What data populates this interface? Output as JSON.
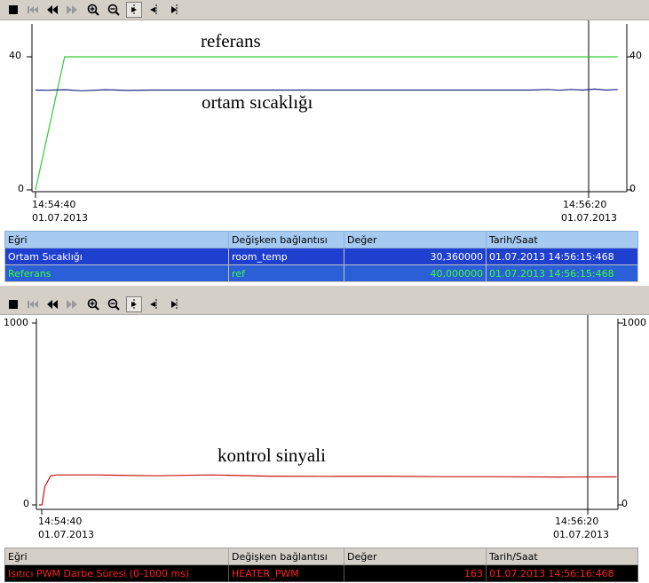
{
  "toolbar": {
    "buttons": [
      "stop-icon",
      "first-icon",
      "rewind-icon",
      "forward-icon",
      "zoom-in-icon",
      "zoom-out-icon",
      "select-icon",
      "pan-icon",
      "cursor-icon"
    ]
  },
  "panel1": {
    "annotations": {
      "referans": "referans",
      "ortam": "ortam sıcaklığı"
    },
    "y_ticks": {
      "top": "40",
      "bottom": "0",
      "right_top": "40",
      "right_bottom": "0"
    },
    "x_start": {
      "time": "14:54:40",
      "date": "01.07.2013"
    },
    "x_end": {
      "time": "14:56:20",
      "date": "01.07.2013"
    },
    "table": {
      "headers": [
        "Eğri",
        "Değişken bağlantısı",
        "Değer",
        "Tarih/Saat"
      ],
      "rows": [
        {
          "curve": "Ortam Sıcaklığı",
          "variable": "room_temp",
          "value": "30,360000",
          "datetime": "01.07.2013 14:56:15:468",
          "color": "#ffffff",
          "bg": "#1f3fcf"
        },
        {
          "curve": "Referans",
          "variable": "ref",
          "value": "40,000000",
          "datetime": "01.07.2013 14:56:15:468",
          "color": "#39ff3a",
          "bg": "#2a5fd7"
        }
      ]
    }
  },
  "panel2": {
    "annotations": {
      "kontrol": "kontrol sinyali"
    },
    "y_ticks": {
      "top": "1000",
      "bottom": "0",
      "right_top": "1000",
      "right_bottom": "0"
    },
    "x_start": {
      "time": "14:54:40",
      "date": "01.07.2013"
    },
    "x_end": {
      "time": "14:56:20",
      "date": "01.07.2013"
    },
    "table": {
      "headers": [
        "Eğri",
        "Değişken bağlantısı",
        "Değer",
        "Tarih/Saat"
      ],
      "rows": [
        {
          "curve": "Isıtıcı PWM Darbe Süresi (0-1000 ms)",
          "variable": "HEATER_PWM",
          "value": "163",
          "datetime": "01.07.2013 14:56:16:468",
          "color": "#ff2020",
          "bg": "#000000"
        }
      ]
    }
  },
  "chart_data": [
    {
      "type": "line",
      "x_range_seconds": [
        0,
        100
      ],
      "ylim": [
        0,
        40
      ],
      "cursor_x_seconds": 95,
      "series": [
        {
          "name": "Referans",
          "color": "#33cc33",
          "x": [
            0,
            5,
            5.3,
            100
          ],
          "y": [
            0,
            40,
            40,
            40
          ]
        },
        {
          "name": "Ortam Sıcaklığı",
          "color": "#1a2a80",
          "x": [
            0,
            2,
            5,
            8,
            12,
            16,
            20,
            30,
            40,
            50,
            60,
            70,
            80,
            85,
            88,
            90,
            92,
            94,
            96,
            98,
            100
          ],
          "y": [
            30.0,
            29.95,
            30.1,
            29.8,
            30.1,
            29.9,
            30.0,
            30.0,
            30.0,
            30.0,
            30.0,
            30.0,
            30.0,
            30.0,
            30.2,
            29.95,
            30.2,
            30.0,
            30.3,
            30.0,
            30.2
          ]
        }
      ]
    },
    {
      "type": "line",
      "x_range_seconds": [
        0,
        100
      ],
      "ylim": [
        0,
        1000
      ],
      "cursor_x_seconds": 95,
      "series": [
        {
          "name": "Isıtıcı PWM Darbe Süresi (0-1000 ms)",
          "color": "#cc1111",
          "x": [
            0,
            0.5,
            1.0,
            2.0,
            3.0,
            10,
            20,
            30,
            40,
            50,
            60,
            70,
            80,
            90,
            100
          ],
          "y": [
            0,
            0,
            100,
            160,
            165,
            165,
            160,
            165,
            158,
            157,
            158,
            155,
            155,
            153,
            154
          ]
        }
      ]
    }
  ]
}
